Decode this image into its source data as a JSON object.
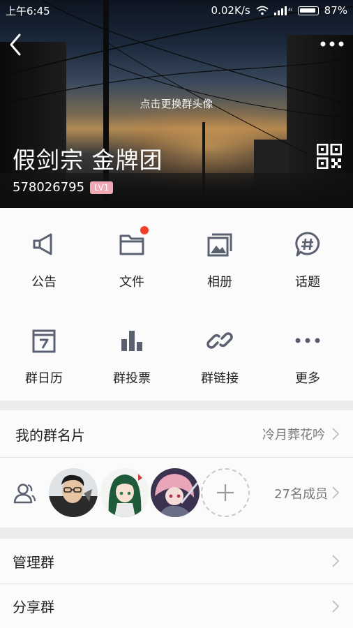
{
  "status_bar": {
    "time": "上午6:45",
    "speed": "0.02K/s",
    "battery": "87%"
  },
  "header": {
    "change_avatar_hint": "点击更换群头像",
    "group_name": "假剑宗 金牌团",
    "group_id": "578026795",
    "level": "LV1"
  },
  "features": [
    {
      "label": "公告",
      "icon": "megaphone-icon"
    },
    {
      "label": "文件",
      "icon": "folder-icon",
      "badge": true
    },
    {
      "label": "相册",
      "icon": "photo-album-icon"
    },
    {
      "label": "话题",
      "icon": "topic-chat-icon"
    },
    {
      "label": "群日历",
      "icon": "calendar-icon"
    },
    {
      "label": "群投票",
      "icon": "bar-chart-icon"
    },
    {
      "label": "群链接",
      "icon": "link-icon"
    },
    {
      "label": "更多",
      "icon": "more-dots-icon"
    }
  ],
  "my_card": {
    "label": "我的群名片",
    "value": "冷月葬花吟"
  },
  "members": {
    "count_label": "27名成员"
  },
  "manage": {
    "label": "管理群"
  },
  "share": {
    "label": "分享群"
  },
  "colors": {
    "icon_gray": "#5a6070",
    "badge_red": "#f0402a",
    "level_pink": "#f0a8b4"
  }
}
